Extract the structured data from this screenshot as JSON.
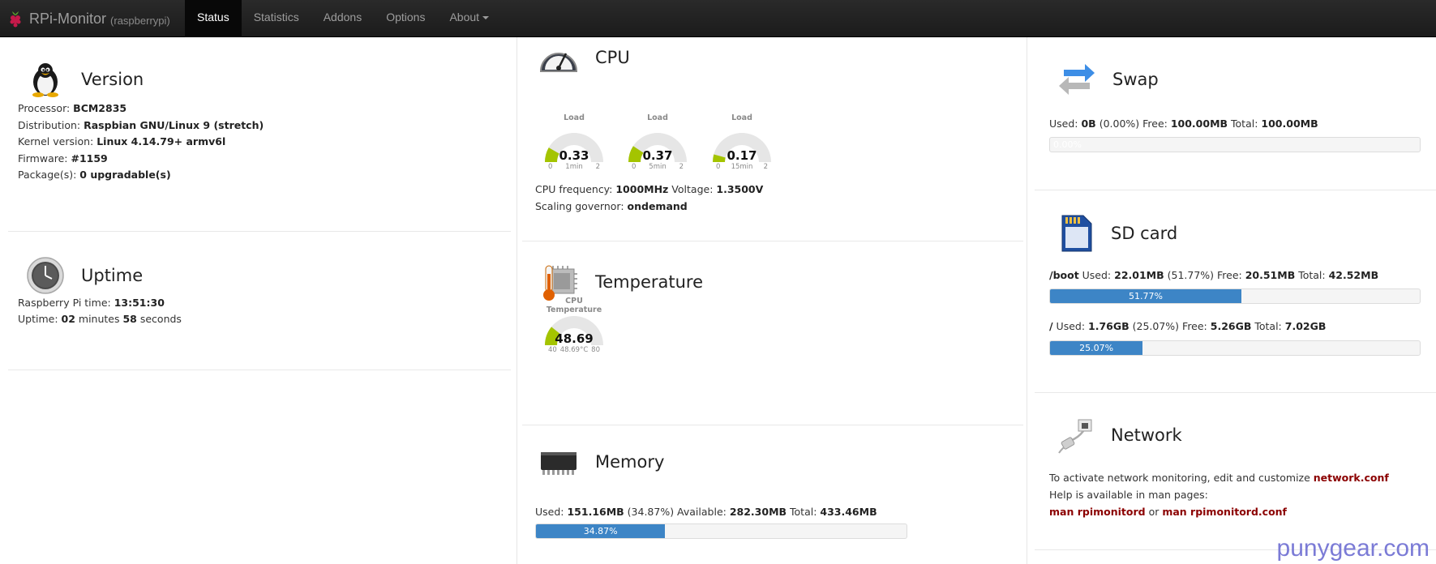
{
  "navbar": {
    "brand": "RPi-Monitor",
    "host": "(raspberrypi)",
    "items": [
      "Status",
      "Statistics",
      "Addons",
      "Options",
      "About"
    ]
  },
  "version": {
    "title": "Version",
    "rows": [
      {
        "label": "Processor: ",
        "value": "BCM2835"
      },
      {
        "label": "Distribution: ",
        "value": "Raspbian GNU/Linux 9 (stretch)"
      },
      {
        "label": "Kernel version: ",
        "value": "Linux 4.14.79+ armv6l"
      },
      {
        "label": "Firmware: ",
        "value": "#1159"
      },
      {
        "label": "Package(s): ",
        "value": "0 upgradable(s)"
      }
    ]
  },
  "uptime": {
    "title": "Uptime",
    "pi_time_label": "Raspberry Pi time: ",
    "pi_time": "13:51:30",
    "uptime_label": "Uptime: ",
    "minutes": "02",
    "minutes_unit": " minutes ",
    "seconds": "58",
    "seconds_unit": " seconds"
  },
  "cpu": {
    "title": "CPU",
    "gauges": [
      {
        "title": "Load",
        "value": "0.33",
        "min": "0",
        "max": "2",
        "label": "1min",
        "fraction": 0.165
      },
      {
        "title": "Load",
        "value": "0.37",
        "min": "0",
        "max": "2",
        "label": "5min",
        "fraction": 0.185
      },
      {
        "title": "Load",
        "value": "0.17",
        "min": "0",
        "max": "2",
        "label": "15min",
        "fraction": 0.085
      }
    ],
    "freq_label": "CPU frequency: ",
    "freq": "1000MHz",
    "volt_label": " Voltage: ",
    "volt": "1.3500V",
    "gov_label": "Scaling governor: ",
    "gov": "ondemand"
  },
  "temperature": {
    "title": "Temperature",
    "gauge": {
      "title": "CPU Temperature",
      "value": "48.69",
      "min": "40",
      "max": "80",
      "label": "48.69°C",
      "fraction": 0.217
    }
  },
  "memory": {
    "title": "Memory",
    "used_label": "Used: ",
    "used": "151.16MB",
    "used_pct": " (34.87%)",
    "avail_label": " Available: ",
    "avail": "282.30MB",
    "total_label": " Total: ",
    "total": "433.46MB",
    "bar_text": "34.87%",
    "bar_fraction": 0.3487
  },
  "swap": {
    "title": "Swap",
    "used_label": "Used: ",
    "used": "0B",
    "used_pct": " (0.00%)",
    "free_label": " Free: ",
    "free": "100.00MB",
    "total_label": " Total: ",
    "total": "100.00MB",
    "bar_text": "0.00%",
    "bar_fraction": 0
  },
  "sdcard": {
    "title": "SD card",
    "mounts": [
      {
        "mount": "/boot",
        "used_label": " Used: ",
        "used": "22.01MB",
        "used_pct": " (51.77%)",
        "free_label": " Free: ",
        "free": "20.51MB",
        "total_label": " Total: ",
        "total": "42.52MB",
        "bar_text": "51.77%",
        "bar_fraction": 0.5177
      },
      {
        "mount": "/",
        "used_label": " Used: ",
        "used": "1.76GB",
        "used_pct": " (25.07%)",
        "free_label": " Free: ",
        "free": "5.26GB",
        "total_label": " Total: ",
        "total": "7.02GB",
        "bar_text": "25.07%",
        "bar_fraction": 0.2507
      }
    ]
  },
  "network": {
    "title": "Network",
    "line1": "To activate network monitoring, edit and customize ",
    "link1": "network.conf",
    "line2": "Help is available in man pages:",
    "link2": "man rpimonitord",
    "or": " or ",
    "link3": "man rpimonitord.conf"
  },
  "watermark": "punygear.com",
  "colors": {
    "bar": "#3d85c6",
    "gauge_fill": "#a4c400",
    "gauge_bg": "#e6e6e6",
    "link": "#8b0000"
  }
}
